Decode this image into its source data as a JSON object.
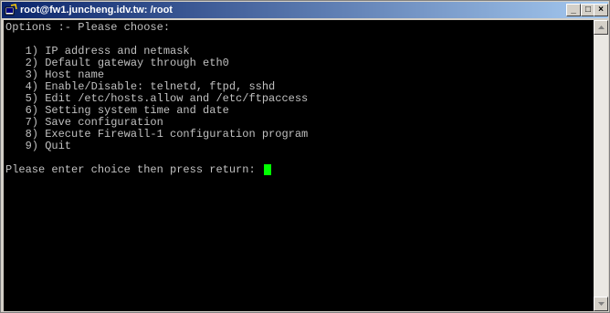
{
  "window": {
    "title": "root@fw1.juncheng.idv.tw: /root",
    "controls": {
      "minimize": "_",
      "maximize": "□",
      "close": "×"
    }
  },
  "terminal": {
    "lines": [
      "Options :- Please choose:",
      "",
      "   1) IP address and netmask",
      "   2) Default gateway through eth0",
      "   3) Host name",
      "   4) Enable/Disable: telnetd, ftpd, sshd",
      "   5) Edit /etc/hosts.allow and /etc/ftpaccess",
      "   6) Setting system time and date",
      "   7) Save configuration",
      "   8) Execute Firewall-1 configuration program",
      "   9) Quit",
      "",
      "Please enter choice then press return: "
    ],
    "text_color": "#c0c0c0",
    "background": "#000000",
    "cursor_color": "#00ff00"
  },
  "icons": {
    "app": "putty-terminal-icon",
    "scroll_up": "scroll-up-arrow-icon",
    "scroll_down": "scroll-down-arrow-icon"
  }
}
